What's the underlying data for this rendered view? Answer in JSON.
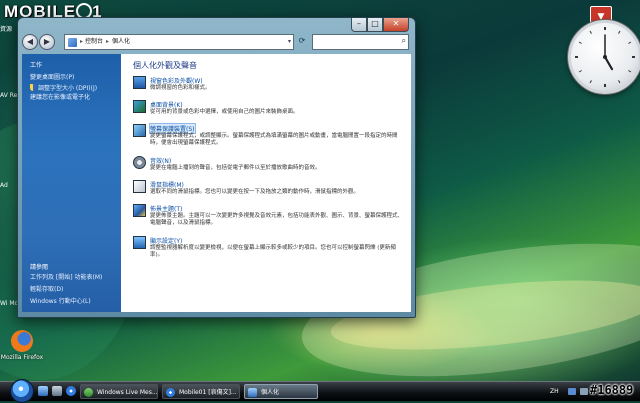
{
  "watermark": {
    "text_left": "MOBILE",
    "text_right": "1"
  },
  "stamp": "#16889",
  "desktop": {
    "icons": [
      {
        "label": "Mozilla Firefox"
      },
      {
        "label": "Windows Live Messenger"
      }
    ],
    "left_fragments": [
      "資源",
      "AV Re",
      "Ad",
      "Wi Mo"
    ]
  },
  "clock": {
    "hour": 5,
    "minute": 0
  },
  "window": {
    "breadcrumb": [
      "控制台",
      "個人化"
    ],
    "breadcrumb_sep": "▸",
    "sidebar": {
      "tasks_heading": "工作",
      "tasks": [
        {
          "label": "變更桌面圖示(P)",
          "shield": false
        },
        {
          "label": "調整字型大小 (DPI)(J)",
          "shield": true
        },
        {
          "label": "建議您在影像或電子化",
          "shield": false
        }
      ],
      "see_also_heading": "請參閱",
      "see_also": [
        "工作列及 [開始] 功能表(M)",
        "輕鬆存取(D)",
        "Windows 行動中心(L)"
      ]
    },
    "content": {
      "title": "個人化外觀及聲音",
      "items": [
        {
          "icon": "window-color-icon",
          "title": "視窗色彩及外觀(W)",
          "desc": "微調視窗的色彩和樣式。",
          "selected": false
        },
        {
          "icon": "desktop-background-icon",
          "title": "桌面背景(K)",
          "desc": "從可用的背景或色彩中選擇，或使用自己的圖片來裝飾桌面。",
          "selected": false
        },
        {
          "icon": "screensaver-icon",
          "title": "螢幕保護裝置(S)",
          "desc": "變更螢幕保護程式，或調整顯示。螢幕保護程式為填滿螢幕的圖片或動畫，當電腦閒置一段指定的時間時，便會出現螢幕保護程式。",
          "selected": true
        },
        {
          "icon": "sound-icon",
          "title": "音效(N)",
          "desc": "變更在電腦上播到的聲音，包括從電子郵件以至於播放歌曲時的音效。",
          "selected": false
        },
        {
          "icon": "mouse-pointer-icon",
          "title": "滑鼠指標(M)",
          "desc": "選取不同的滑鼠指標。您也可以變更在按一下及拖放之類的動作時，滑鼠指標的外觀。",
          "selected": false
        },
        {
          "icon": "theme-icon",
          "title": "佈景主題(T)",
          "desc": "變更佈景主題。主題可以一次變更許多視覺及音效元素，包括功能表外觀、圖示、背景、螢幕保護程式、電腦聲音，以及滑鼠指標。",
          "selected": false
        },
        {
          "icon": "display-settings-icon",
          "title": "顯示設定(Y)",
          "desc": "調整監視器解析度以變更檢視，以便在螢幕上顯示較多或較少的項目。您也可以控制螢幕閃爍 (更新頻率)。",
          "selected": false
        }
      ]
    }
  },
  "taskbar": {
    "buttons": [
      {
        "label": "Windows Live Mes...",
        "active": false
      },
      {
        "label": "Mobile01 [哀傷文]...",
        "active": false
      },
      {
        "label": "個人化",
        "active": true
      }
    ],
    "tray": {
      "language": "ZH"
    }
  },
  "colors": {
    "sidebar": "#2b72bd",
    "link": "#0b4fa3",
    "title": "#1e3a8a"
  }
}
